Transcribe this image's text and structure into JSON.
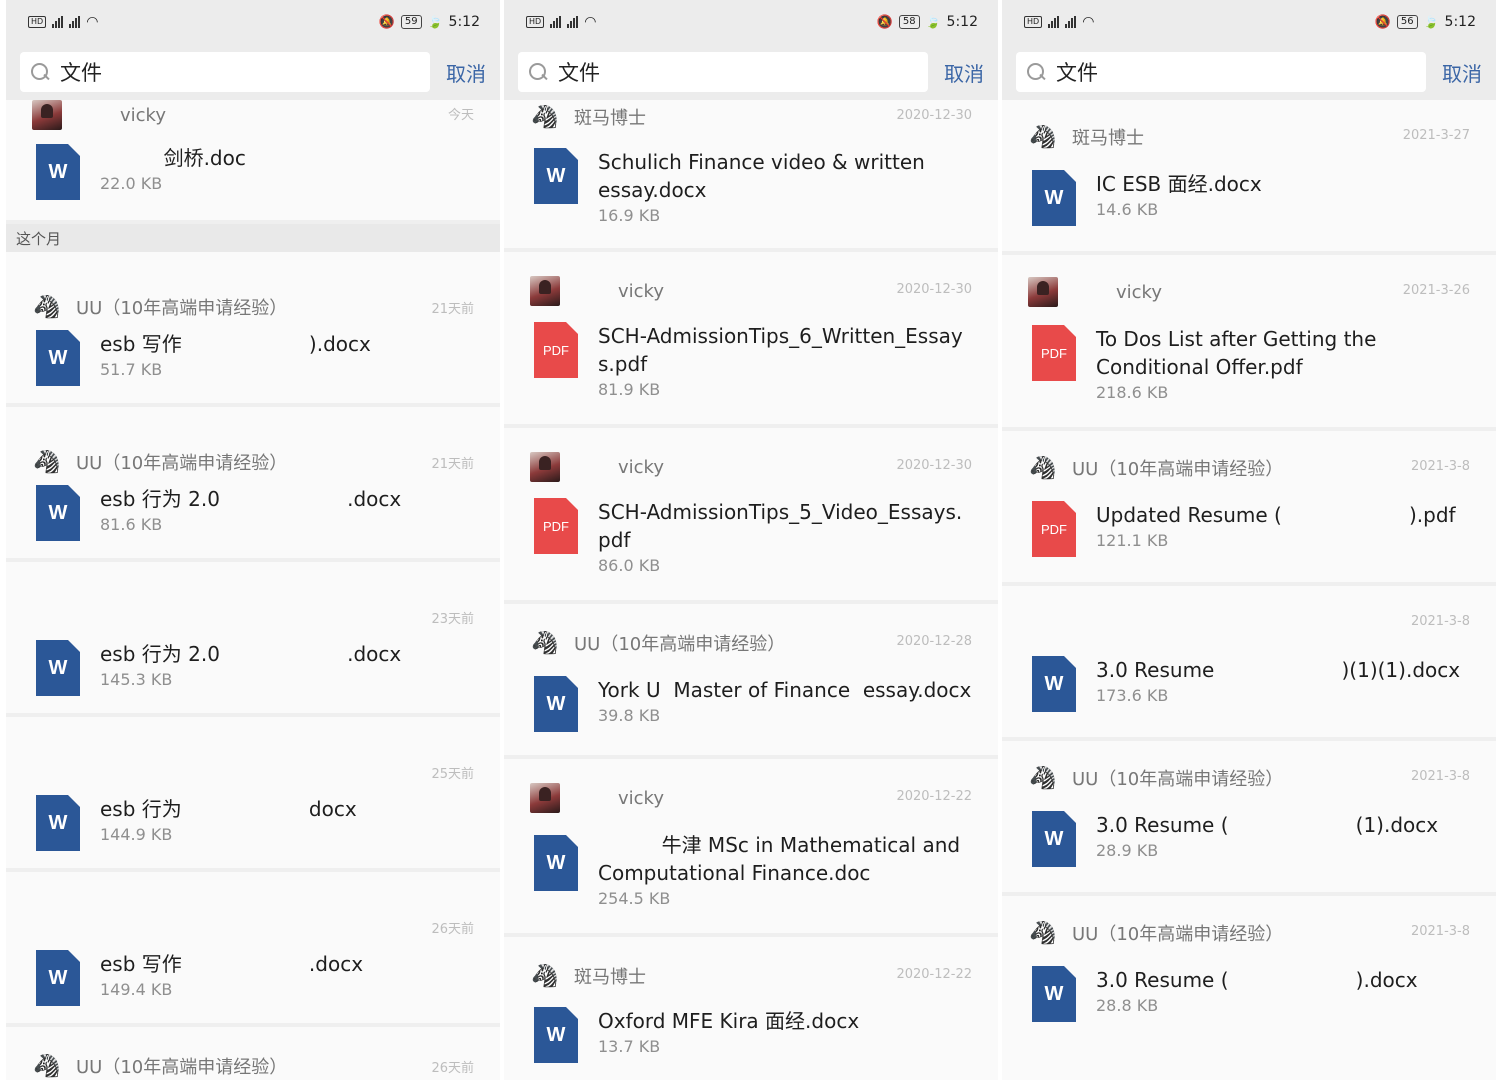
{
  "status": {
    "time": "5:12",
    "batteries": [
      "59",
      "58",
      "56"
    ],
    "signal": "46"
  },
  "search": {
    "query": "文件",
    "cancel_label": "取消"
  },
  "panel0": {
    "separator": "这个月",
    "items": [
      {
        "sender": "vicky",
        "date": "今天",
        "name": "          剑桥.doc",
        "size": "22.0 KB",
        "type": "W"
      },
      {
        "sender": "UU（10年高端申请经验）",
        "date": "21天前",
        "name": "esb 写作                    ).docx",
        "size": "51.7 KB",
        "type": "W"
      },
      {
        "sender": "UU（10年高端申请经验）",
        "date": "21天前",
        "name": "esb 行为 2.0                    .docx",
        "size": "81.6 KB",
        "type": "W"
      },
      {
        "sender": "",
        "date": "23天前",
        "name": "esb 行为 2.0                    .docx",
        "size": "145.3 KB",
        "type": "W"
      },
      {
        "sender": "",
        "date": "25天前",
        "name": "esb 行为                    docx",
        "size": "144.9 KB",
        "type": "W"
      },
      {
        "sender": "",
        "date": "26天前",
        "name": "esb 写作                    .docx",
        "size": "149.4 KB",
        "type": "W"
      },
      {
        "sender": "UU（10年高端申请经验）",
        "date": "26天前",
        "name": "",
        "size": "",
        "type": "W"
      }
    ]
  },
  "panel1": {
    "items": [
      {
        "sender": "斑马博士",
        "date": "2020-12-30",
        "name": "Schulich Finance video & written essay.docx",
        "size": "16.9 KB",
        "type": "W"
      },
      {
        "sender": "vicky",
        "date": "2020-12-30",
        "name": "SCH-AdmissionTips_6_Written_Essays.pdf",
        "size": "81.9 KB",
        "type": "PDF"
      },
      {
        "sender": "vicky",
        "date": "2020-12-30",
        "name": "SCH-AdmissionTips_5_Video_Essays.pdf",
        "size": "86.0 KB",
        "type": "PDF"
      },
      {
        "sender": "UU（10年高端申请经验）",
        "date": "2020-12-28",
        "name": "York U  Master of Finance  essay.docx",
        "size": "39.8 KB",
        "type": "W"
      },
      {
        "sender": "vicky",
        "date": "2020-12-22",
        "name": "          牛津 MSc in Mathematical and Computational Finance.doc",
        "size": "254.5 KB",
        "type": "W"
      },
      {
        "sender": "斑马博士",
        "date": "2020-12-22",
        "name": "Oxford MFE Kira 面经.docx",
        "size": "13.7 KB",
        "type": "W"
      }
    ]
  },
  "panel2": {
    "items": [
      {
        "sender": "斑马博士",
        "date": "2021-3-27",
        "name": "IC ESB 面经.docx",
        "size": "14.6 KB",
        "type": "W"
      },
      {
        "sender": "vicky",
        "date": "2021-3-26",
        "name": "To Dos List after Getting the Conditional Offer.pdf",
        "size": "218.6 KB",
        "type": "PDF"
      },
      {
        "sender": "UU（10年高端申请经验）",
        "date": "2021-3-8",
        "name": "Updated Resume (                    ).pdf",
        "size": "121.1 KB",
        "type": "PDF"
      },
      {
        "sender": "",
        "date": "2021-3-8",
        "name": "3.0 Resume                    )(1)(1).docx",
        "size": "173.6 KB",
        "type": "W"
      },
      {
        "sender": "UU（10年高端申请经验）",
        "date": "2021-3-8",
        "name": "3.0 Resume (                    (1).docx",
        "size": "28.9 KB",
        "type": "W"
      },
      {
        "sender": "UU（10年高端申请经验）",
        "date": "2021-3-8",
        "name": "3.0 Resume (                    ).docx",
        "size": "28.8 KB",
        "type": "W"
      }
    ]
  },
  "colors": {
    "word": "#2b5797",
    "pdf": "#e84a4a",
    "cancel": "#3b66a6"
  },
  "icons": {
    "avatar": "vicky-avatar",
    "mascot": "zebra-mascot-icon"
  }
}
